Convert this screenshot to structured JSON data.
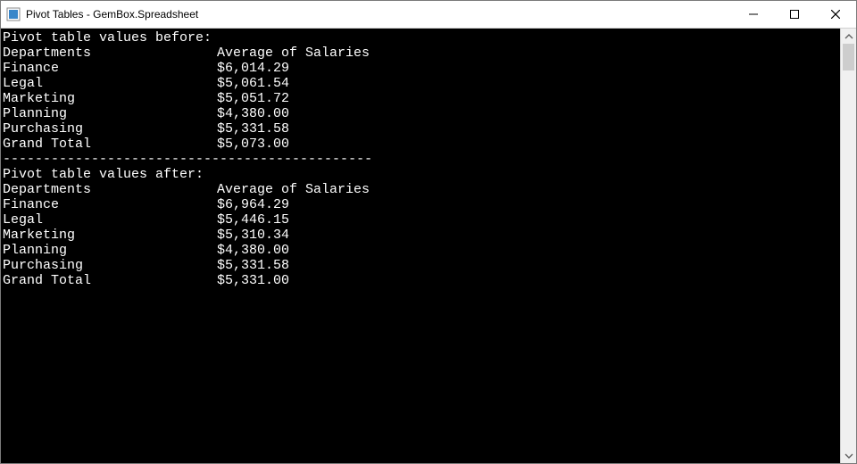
{
  "window": {
    "title": "Pivot Tables - GemBox.Spreadsheet"
  },
  "console": {
    "before_heading": "Pivot table values before:",
    "after_heading": "Pivot table values after:",
    "separator": "----------------------------------------------",
    "col_headers": {
      "dept": "Departments",
      "val": "Average of Salaries"
    },
    "before_rows": [
      {
        "dept": "Finance",
        "val": "$6,014.29"
      },
      {
        "dept": "Legal",
        "val": "$5,061.54"
      },
      {
        "dept": "Marketing",
        "val": "$5,051.72"
      },
      {
        "dept": "Planning",
        "val": "$4,380.00"
      },
      {
        "dept": "Purchasing",
        "val": "$5,331.58"
      },
      {
        "dept": "Grand Total",
        "val": "$5,073.00"
      }
    ],
    "after_rows": [
      {
        "dept": "Finance",
        "val": "$6,964.29"
      },
      {
        "dept": "Legal",
        "val": "$5,446.15"
      },
      {
        "dept": "Marketing",
        "val": "$5,310.34"
      },
      {
        "dept": "Planning",
        "val": "$4,380.00"
      },
      {
        "dept": "Purchasing",
        "val": "$5,331.58"
      },
      {
        "dept": "Grand Total",
        "val": "$5,331.00"
      }
    ]
  }
}
